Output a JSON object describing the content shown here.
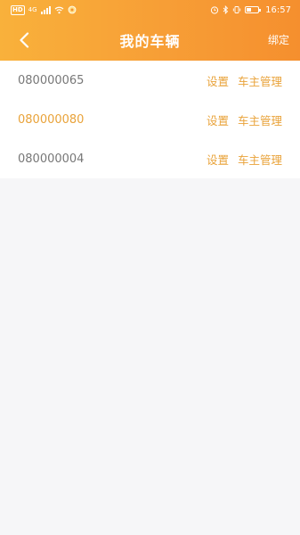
{
  "status_bar": {
    "time": "16:57",
    "network": "4G",
    "battery_level": 0.4
  },
  "header": {
    "title": "我的车辆",
    "bind_label": "绑定"
  },
  "vehicles": [
    {
      "id": "080000065",
      "settings_label": "设置",
      "owner_label": "车主管理"
    },
    {
      "id": "080000080",
      "settings_label": "设置",
      "owner_label": "车主管理"
    },
    {
      "id": "080000004",
      "settings_label": "设置",
      "owner_label": "车主管理"
    }
  ],
  "colors": {
    "accent": "#f79e36",
    "link": "#e9a33a",
    "text_gray": "#777777",
    "page_bg": "#f6f6f8"
  }
}
